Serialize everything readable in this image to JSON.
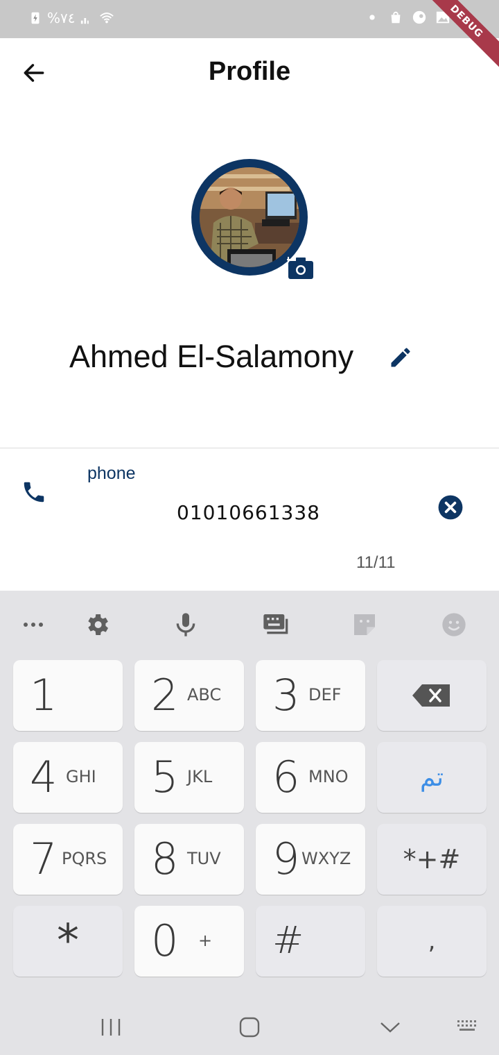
{
  "status_bar": {
    "left_text": "%٧٤",
    "debug_label": "DEBUG"
  },
  "app_bar": {
    "title": "Profile",
    "back_icon": "arrow-left-icon"
  },
  "profile": {
    "name": "Ahmed El-Salamony",
    "edit_icon": "pencil-icon",
    "camera_icon": "camera-icon"
  },
  "phone_field": {
    "label": "phone",
    "value": "01010661338",
    "counter": "11/11",
    "icon": "phone-icon",
    "clear_icon": "close-circle-icon"
  },
  "keyboard": {
    "toolbar": [
      "more-icon",
      "gear-icon",
      "microphone-icon",
      "keyboard-icon",
      "sticker-icon",
      "emoji-icon"
    ],
    "keys": [
      {
        "num": "1",
        "letters": ""
      },
      {
        "num": "2",
        "letters": "ABC"
      },
      {
        "num": "3",
        "letters": "DEF"
      },
      {
        "num": "4",
        "letters": "GHI"
      },
      {
        "num": "5",
        "letters": "JKL"
      },
      {
        "num": "6",
        "letters": "MNO"
      },
      {
        "num": "7",
        "letters": "PQRS"
      },
      {
        "num": "8",
        "letters": "TUV"
      },
      {
        "num": "9",
        "letters": "WXYZ"
      },
      {
        "num": "0",
        "letters": "+"
      }
    ],
    "done_label": "تم",
    "symbols_label": "*+#",
    "star_label": "*",
    "hash_label": "#",
    "comma_label": ","
  },
  "colors": {
    "primary": "#0d3563",
    "keyboard_bg": "#e3e3e6",
    "done_blue": "#3d8ee6"
  }
}
